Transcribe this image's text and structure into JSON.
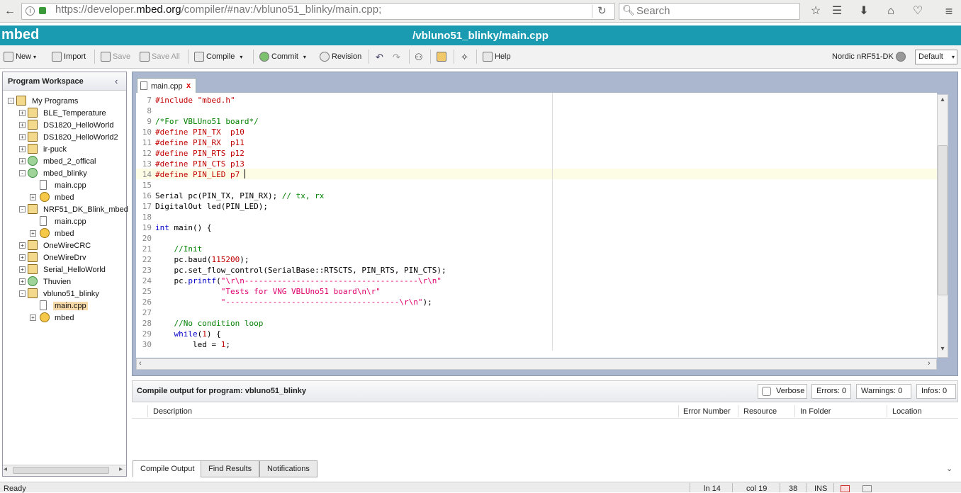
{
  "browser": {
    "url_prefix": "https://developer.",
    "url_host": "mbed.org",
    "url_path": "/compiler/#nav:/vbluno51_blinky/main.cpp;",
    "search_placeholder": "Search"
  },
  "app": {
    "logo": "mbed",
    "title": "/vbluno51_blinky/main.cpp"
  },
  "toolbar": {
    "new": "New",
    "import": "Import",
    "save": "Save",
    "save_all": "Save All",
    "compile": "Compile",
    "commit": "Commit",
    "revision": "Revision",
    "help": "Help",
    "target": "Nordic nRF51-DK",
    "profile": "Default"
  },
  "workspace": {
    "title": "Program Workspace",
    "root": "My Programs",
    "items": [
      {
        "label": "BLE_Temperature"
      },
      {
        "label": "DS1820_HelloWorld"
      },
      {
        "label": "DS1820_HelloWorld2"
      },
      {
        "label": "ir-puck"
      },
      {
        "label": "mbed_2_offical"
      },
      {
        "label": "mbed_blinky"
      },
      {
        "label": "main.cpp"
      },
      {
        "label": "mbed"
      },
      {
        "label": "NRF51_DK_Blink_mbed"
      },
      {
        "label": "main.cpp"
      },
      {
        "label": "mbed"
      },
      {
        "label": "OneWireCRC"
      },
      {
        "label": "OneWireDrv"
      },
      {
        "label": "Serial_HelloWorld"
      },
      {
        "label": "Thuvien"
      },
      {
        "label": "vbluno51_blinky"
      },
      {
        "label": "main.cpp"
      },
      {
        "label": "mbed"
      }
    ]
  },
  "editor": {
    "tab": "main.cpp",
    "lines": [
      {
        "n": "7",
        "text": "#include \"mbed.h\""
      },
      {
        "n": "8",
        "text": ""
      },
      {
        "n": "9",
        "text": "/*For VBLUno51 board*/"
      },
      {
        "n": "10",
        "text": "#define PIN_TX  p10"
      },
      {
        "n": "11",
        "text": "#define PIN_RX  p11"
      },
      {
        "n": "12",
        "text": "#define PIN_RTS p12"
      },
      {
        "n": "13",
        "text": "#define PIN_CTS p13"
      },
      {
        "n": "14",
        "text": "#define PIN_LED p7"
      },
      {
        "n": "15",
        "text": ""
      },
      {
        "n": "16",
        "text": "Serial pc(PIN_TX, PIN_RX); // tx, rx"
      },
      {
        "n": "17",
        "text": "DigitalOut led(PIN_LED);"
      },
      {
        "n": "18",
        "text": ""
      },
      {
        "n": "19",
        "text": "int main() {"
      },
      {
        "n": "20",
        "text": ""
      },
      {
        "n": "21",
        "text": "    //Init"
      },
      {
        "n": "22",
        "text": "    pc.baud(115200);"
      },
      {
        "n": "23",
        "text": "    pc.set_flow_control(SerialBase::RTSCTS, PIN_RTS, PIN_CTS);"
      },
      {
        "n": "24",
        "text": "    pc.printf(\"\\r\\n-------------------------------------\\r\\n\""
      },
      {
        "n": "25",
        "text": "              \"Tests for VNG VBLUno51 board\\n\\r\""
      },
      {
        "n": "26",
        "text": "              \"-------------------------------------\\r\\n\");"
      },
      {
        "n": "27",
        "text": ""
      },
      {
        "n": "28",
        "text": "    //No condition loop"
      },
      {
        "n": "29",
        "text": "    while(1) {"
      },
      {
        "n": "30",
        "text": "        led = 1;"
      }
    ]
  },
  "output": {
    "title": "Compile output for program: vbluno51_blinky",
    "verbose": "Verbose",
    "errors": "Errors: 0",
    "warnings": "Warnings: 0",
    "infos": "Infos: 0",
    "columns": [
      "Description",
      "Error Number",
      "Resource",
      "In Folder",
      "Location"
    ],
    "tabs": [
      "Compile Output",
      "Find Results",
      "Notifications"
    ]
  },
  "status": {
    "ready": "Ready",
    "line": "ln 14",
    "col": "col 19",
    "num": "38",
    "mode": "INS"
  },
  "colors": {
    "brand": "#1a9bb1",
    "keyword": "#0000c8",
    "string": "#e0006c",
    "comment": "#008000",
    "preprocessor": "#c00000"
  }
}
